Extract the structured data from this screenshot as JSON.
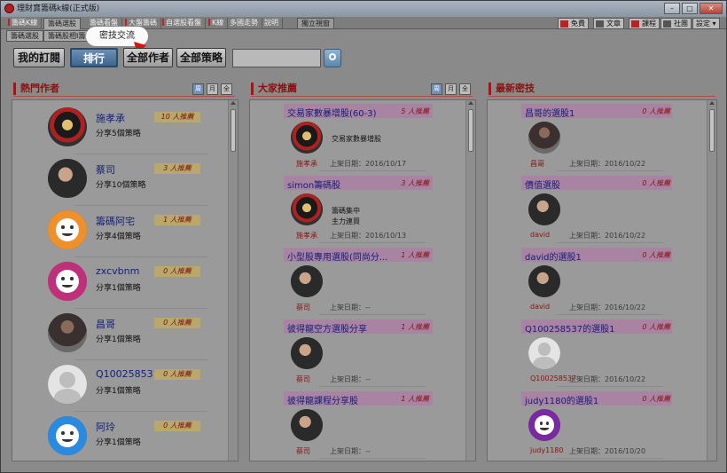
{
  "window": {
    "title": "理財寶籌碼k線(正式版)"
  },
  "tabs": [
    "籌碼K線",
    "籌碼選股",
    "籌碼看盤",
    "大盤籌碼",
    "自選股看盤",
    "K線",
    "多國走勢",
    "說明",
    "獨立視窗"
  ],
  "right_tools": [
    "免費",
    "文章",
    "課程",
    "社團",
    "設定"
  ],
  "subtabs": [
    "籌碼選股",
    "籌碼股相I籌"
  ],
  "bubble_label": "密技交流",
  "buttons": {
    "my_sub": "我的訂閱",
    "rank": "排行",
    "all_authors": "全部作者",
    "all_strategies": "全部策略"
  },
  "search": {
    "placeholder": ""
  },
  "period": [
    "周",
    "月",
    "全"
  ],
  "panels": {
    "hot": "熱門作者",
    "recommend": "大家推薦",
    "latest": "最新密技"
  },
  "hot_authors": [
    {
      "name": "施孝承",
      "share": "分享5個策略",
      "rec": "10 人推薦",
      "avatar": "photo3"
    },
    {
      "name": "蔡司",
      "share": "分享10個策略",
      "rec": "3 人推薦",
      "avatar": "photo"
    },
    {
      "name": "籌碼阿宅",
      "share": "分享4個策略",
      "rec": "1 人推薦",
      "avatar": "face-orange"
    },
    {
      "name": "zxcvbnm",
      "share": "分享1個策略",
      "rec": "0 人推薦",
      "avatar": "face-pink"
    },
    {
      "name": "昌哥",
      "share": "分享1個策略",
      "rec": "0 人推薦",
      "avatar": "photo2"
    },
    {
      "name": "Q100258537",
      "share": "分享1個策略",
      "rec": "0 人推薦",
      "avatar": "ghost"
    },
    {
      "name": "阿玲",
      "share": "分享1個策略",
      "rec": "0 人推薦",
      "avatar": "face-blue"
    }
  ],
  "recommended": [
    {
      "title": "交易家數暴增股(60-3)",
      "rec": "5 人推薦",
      "desc": "交易家數暴增股",
      "user": "施孝承",
      "date": "上架日期：2016/10/17",
      "avatar": "photo3"
    },
    {
      "title": "simon籌碼股",
      "rec": "3 人推薦",
      "desc": "籌碼集中\n主力連買",
      "user": "施孝承",
      "date": "上架日期：2016/10/13",
      "avatar": "photo3"
    },
    {
      "title": "小型股專用選股(同尚分...",
      "rec": "1 人推薦",
      "desc": "",
      "user": "蔡司",
      "date": "上架日期：--",
      "avatar": "photo"
    },
    {
      "title": "彼得龍空方選股分享",
      "rec": "1 人推薦",
      "desc": "",
      "user": "蔡司",
      "date": "上架日期：--",
      "avatar": "photo"
    },
    {
      "title": "彼得龍課程分享股",
      "rec": "1 人推薦",
      "desc": "",
      "user": "蔡司",
      "date": "上架日期：--",
      "avatar": "photo"
    }
  ],
  "latest": [
    {
      "title": "昌哥的選股1",
      "rec": "0 人推薦",
      "user": "昌哥",
      "date": "上架日期：2016/10/22",
      "avatar": "photo2"
    },
    {
      "title": "價值選股",
      "rec": "0 人推薦",
      "user": "david",
      "date": "上架日期：2016/10/22",
      "avatar": "photo"
    },
    {
      "title": "david的選股1",
      "rec": "0 人推薦",
      "user": "david",
      "date": "上架日期：2016/10/22",
      "avatar": "photo"
    },
    {
      "title": "Q100258537的選股1",
      "rec": "0 人推薦",
      "user": "Q100258537",
      "date": "上架日期：2016/10/22",
      "avatar": "ghost"
    },
    {
      "title": "judy1180的選股1",
      "rec": "0 人推薦",
      "user": "judy1180",
      "date": "上架日期：2016/10/20",
      "avatar": "face-purple"
    }
  ]
}
